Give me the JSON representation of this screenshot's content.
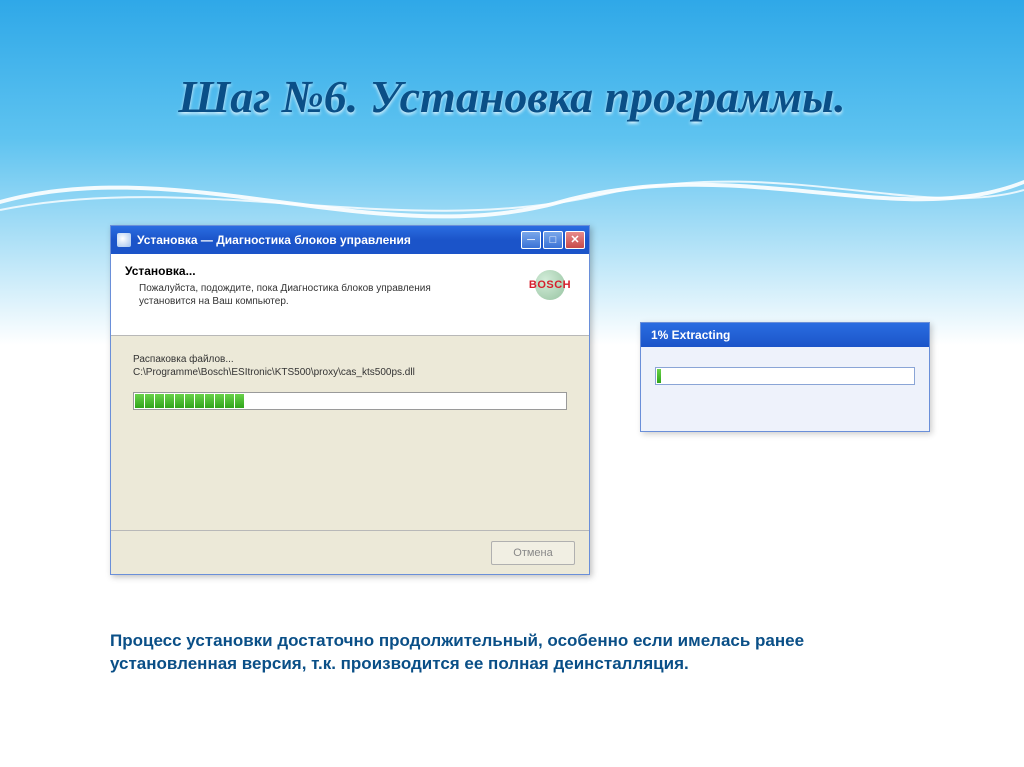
{
  "slide": {
    "title": "Шаг №6. Установка программы."
  },
  "installer": {
    "window_title": "Установка — Диагностика блоков управления",
    "heading": "Установка...",
    "subtext": "Пожалуйста, подождите, пока Диагностика блоков управления установится на Ваш компьютер.",
    "status_line": "Распаковка файлов...",
    "file_path": "C:\\Programme\\Bosch\\ESItronic\\KTS500\\proxy\\cas_kts500ps.dll",
    "cancel_label": "Отмена",
    "logo_text": "BOSCH",
    "progress_segments": 11
  },
  "extract": {
    "title": "1% Extracting"
  },
  "caption": {
    "text": "Процесс установки достаточно продолжительный, особенно если имелась ранее установленная версия, т.к. производится ее полная деинсталляция."
  }
}
